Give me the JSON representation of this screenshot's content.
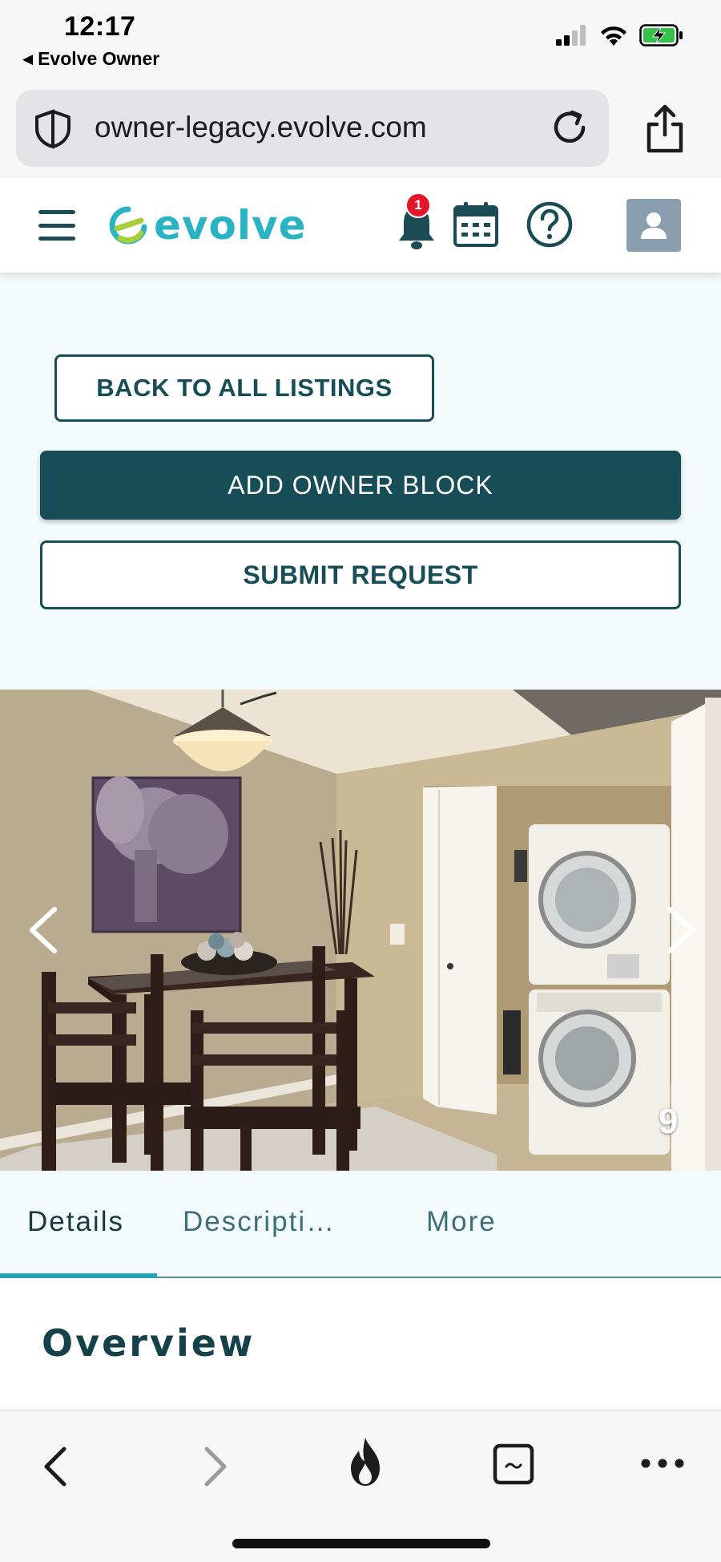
{
  "status_bar": {
    "time": "12:17",
    "back_app": "Evolve Owner"
  },
  "browser": {
    "url": "owner-legacy.evolve.com"
  },
  "header": {
    "logo_text": "evolve",
    "notification_count": "1"
  },
  "actions": {
    "back_label": "BACK TO ALL LISTINGS",
    "add_block_label": "ADD OWNER BLOCK",
    "submit_label": "SUBMIT REQUEST"
  },
  "carousel": {
    "photo_number": "9"
  },
  "tabs": [
    {
      "label": "Details",
      "active": true
    },
    {
      "label": "Descripti…",
      "active": false
    },
    {
      "label": "More",
      "active": false
    }
  ],
  "overview": {
    "title": "Overview"
  },
  "colors": {
    "primary": "#174d56",
    "accent": "#2ab3c2",
    "badge": "#e3152b",
    "logo_green": "#a6cf3a"
  }
}
